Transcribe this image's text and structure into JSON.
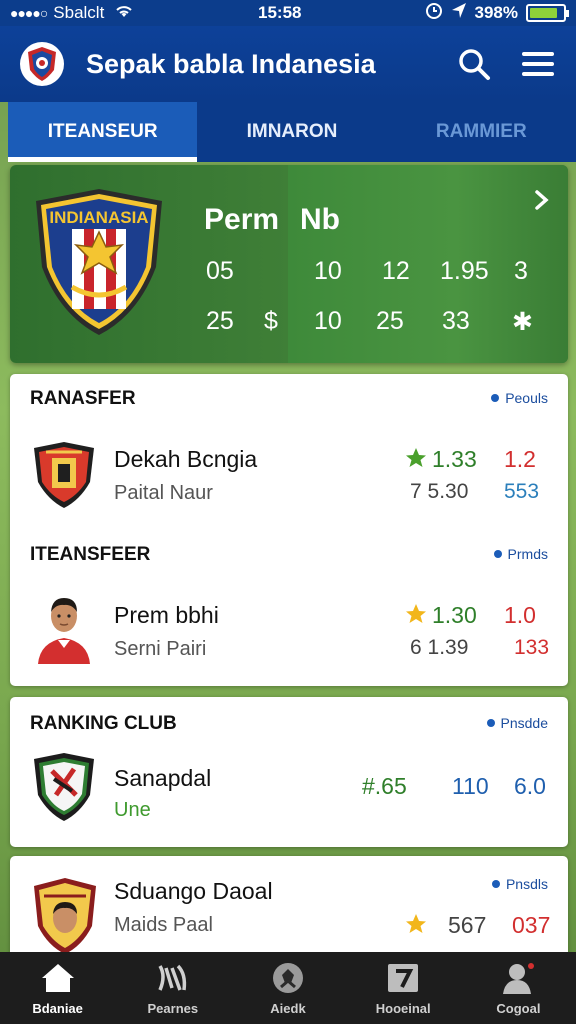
{
  "status_bar": {
    "signal": "●●●●○",
    "carrier": "Sbalclt",
    "time": "15:58",
    "battery": "398%",
    "battery_level": 0.85
  },
  "header": {
    "title": "Sepak babla Indanesia",
    "search_icon": "search-icon",
    "menu_icon": "menu-icon"
  },
  "tabs": [
    {
      "label": "ITEANSEUR",
      "active": true
    },
    {
      "label": "IMNARON",
      "active": false
    },
    {
      "label": "RAMMIER",
      "active": false
    }
  ],
  "hero": {
    "crest_text": "INDIANASIA",
    "col_a": "Perm",
    "col_b": "Nb",
    "row1": [
      "05",
      "10",
      "12",
      "1.95",
      "3"
    ],
    "row2": [
      "25",
      "$",
      "10",
      "25",
      "33",
      "✱"
    ]
  },
  "sections": [
    {
      "title": "RANASFER",
      "link": "Peouls",
      "row": {
        "name": "Dekah Bcngia",
        "sub": "Paital Naur",
        "v1": "1.33",
        "v2": "1.2",
        "v3": "7 5.30",
        "v4": "553"
      }
    },
    {
      "title": "ITEANSFEER",
      "link": "Prmds",
      "row": {
        "name": "Prem bbhi",
        "sub": "Serni Pairi",
        "v1": "1.30",
        "v2": "1.0",
        "v3": "6 1.39",
        "v4": "133"
      }
    },
    {
      "title": "RANKING CLUB",
      "link": "Pnsdde",
      "row": {
        "name": "Sanapdal",
        "sub": "Une",
        "v1": "#.65",
        "v2": "110",
        "v3": "6.0"
      }
    },
    {
      "title": "",
      "link": "Pnsdls",
      "row": {
        "name": "Sduango Daoal",
        "sub": "Maids Paal",
        "v1": "567",
        "v2": "037"
      }
    }
  ],
  "bottom_nav": [
    {
      "label": "Bdaniae",
      "icon": "home-icon",
      "active": true
    },
    {
      "label": "Pearnes",
      "icon": "people-icon",
      "active": false
    },
    {
      "label": "Aiedk",
      "icon": "ball-icon",
      "active": false
    },
    {
      "label": "Hooeinal",
      "icon": "calendar-icon",
      "active": false
    },
    {
      "label": "Cogoal",
      "icon": "profile-icon",
      "active": false
    }
  ],
  "colors": {
    "brand_blue": "#0b3a8a",
    "accent_blue": "#1b5cb8",
    "red": "#d22f2f",
    "green": "#2f7f2a",
    "star": "#f2b61b"
  }
}
